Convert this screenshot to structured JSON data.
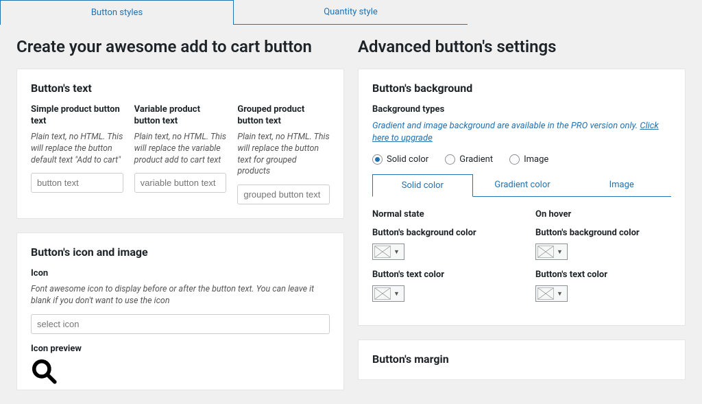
{
  "tabs": {
    "button_styles": "Button styles",
    "quantity_style": "Quantity style"
  },
  "left": {
    "heading": "Create your awesome add to cart button",
    "card1": {
      "title": "Button's text",
      "simple": {
        "title": "Simple product button text",
        "desc": "Plain text, no HTML. This will replace the button default text \"Add to cart\"",
        "placeholder": "button text"
      },
      "variable": {
        "title": "Variable product button text",
        "desc": "Plain text, no HTML. This will replace the variable product add to cart text",
        "placeholder": "variable button text"
      },
      "grouped": {
        "title": "Grouped product button text",
        "desc": "Plain text, no HTML. This will replace the button text for grouped products",
        "placeholder": "grouped button text"
      }
    },
    "card2": {
      "title": "Button's icon and image",
      "icon_label": "Icon",
      "icon_desc": "Font awesome icon to display before or after the button text. You can leave it blank if you don't want to use the icon",
      "icon_placeholder": "select icon",
      "icon_preview_label": "Icon preview"
    }
  },
  "right": {
    "heading": "Advanced button's settings",
    "bg_card": {
      "title": "Button's background",
      "types_label": "Background types",
      "pro_notice_text": "Gradient and image background are available in the PRO version only. ",
      "pro_notice_link": "Click here to upgrade",
      "radios": {
        "solid": "Solid color",
        "gradient": "Gradient",
        "image": "Image"
      },
      "subtabs": {
        "solid": "Solid color",
        "gradient": "Gradient color",
        "image": "Image"
      },
      "normal_state": "Normal state",
      "hover_state": "On hover",
      "bg_color_label": "Button's background color",
      "text_color_label": "Button's text color"
    },
    "margin_card": {
      "title": "Button's margin"
    }
  }
}
